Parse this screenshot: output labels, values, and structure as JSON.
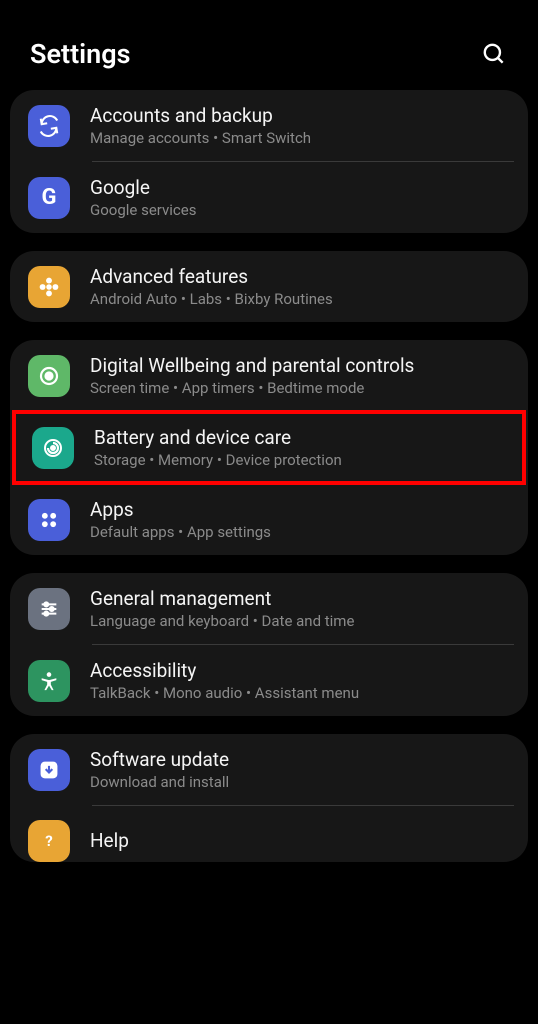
{
  "header": {
    "title": "Settings"
  },
  "groups": [
    {
      "items": [
        {
          "id": "accounts",
          "title": "Accounts and backup",
          "subtitle": "Manage accounts  •  Smart Switch"
        },
        {
          "id": "google",
          "title": "Google",
          "subtitle": "Google services"
        }
      ]
    },
    {
      "items": [
        {
          "id": "advanced",
          "title": "Advanced features",
          "subtitle": "Android Auto  •  Labs  •  Bixby Routines"
        }
      ]
    },
    {
      "items": [
        {
          "id": "wellbeing",
          "title": "Digital Wellbeing and parental controls",
          "subtitle": "Screen time  •  App timers  •  Bedtime mode"
        },
        {
          "id": "battery",
          "title": "Battery and device care",
          "subtitle": "Storage  •  Memory  •  Device protection",
          "highlighted": true
        },
        {
          "id": "apps",
          "title": "Apps",
          "subtitle": "Default apps  •  App settings"
        }
      ]
    },
    {
      "items": [
        {
          "id": "general",
          "title": "General management",
          "subtitle": "Language and keyboard  •  Date and time"
        },
        {
          "id": "accessibility",
          "title": "Accessibility",
          "subtitle": "TalkBack  •  Mono audio  •  Assistant menu"
        }
      ]
    },
    {
      "items": [
        {
          "id": "software",
          "title": "Software update",
          "subtitle": "Download and install"
        },
        {
          "id": "help",
          "title": "Help",
          "subtitle": ""
        }
      ]
    }
  ]
}
